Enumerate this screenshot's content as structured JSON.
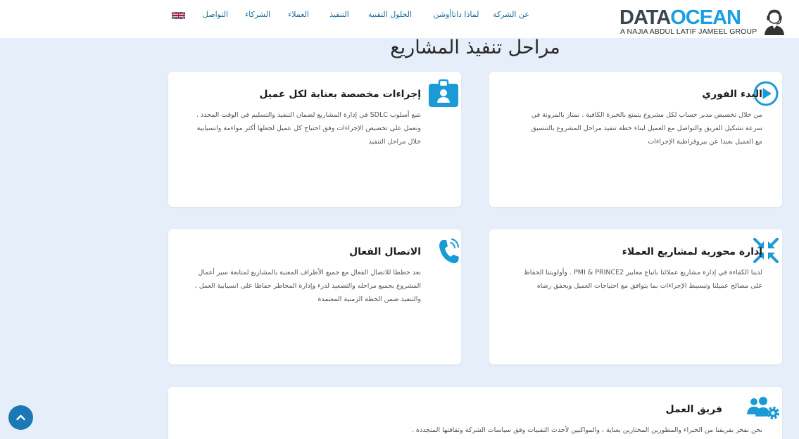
{
  "header": {
    "logo": {
      "main_dark": "DATA",
      "main_accent": "OCEAN",
      "subtitle": "A NAJIA ABDUL LATIF JAMEEL GROUP"
    },
    "nav": [
      {
        "label": "عن الشركة"
      },
      {
        "label": "لماذا داتاأوشن"
      },
      {
        "label": "الحلول التقنية"
      },
      {
        "label": "التنفيذ"
      },
      {
        "label": "العملاء"
      },
      {
        "label": "الشركاء"
      },
      {
        "label": "التواصل"
      }
    ],
    "language_flag": "uk-flag-icon"
  },
  "section": {
    "title": "مراحل تنفيذ المشاريع"
  },
  "cards": [
    {
      "title": "البدء الفوري",
      "icon": "play-circle-icon",
      "text": "من خلال تخصيص مدير حساب لكل مشروع يتمتع بالخبرة الكافية . نمتاز بالمرونة في سرعة تشكيل الفريق والتواصل مع العميل لبناء خطة تنفيذ مراحل المشروع بالتنسيق مع العميل بعيدا عن بيروقراطية الإجراءات"
    },
    {
      "title": "إجراءات مخصصة بعناية لكل عميل",
      "icon": "id-card-icon",
      "text": "نتبع أسلوب SDLC في إدارة المشاريع لضمان التنفيذ والتسليم في الوقت المحدد . ونعمل على تخصيص الإجراءات وفق احتياج كل عميل لجعلها أكثر مواءمة وانسيابية خلال مراحل التنفيذ"
    },
    {
      "title": "إدارة محورية لمشاريع العملاء",
      "icon": "compress-arrows-icon",
      "text": "لدينا الكفاءة في إدارة مشاريع عملائنا باتباع معايير PMI & PRINCE2 . وأولويتنا الحفاظ على مصالح عميلنا وتبسيط الإجراءات بما يتوافق مع احتياجات العميل ويحقق رضاه"
    },
    {
      "title": "الاتصال الفعال",
      "icon": "phone-ringing-icon",
      "text": "نعد خططا للاتصال الفعال مع جميع الأطراف المعنية بالمشاريع لمتابعة سير أعمال المشروع بجميع مراحله والتصعيد لدرء وإدارة المخاطر حفاظا على انسيابية العمل ، والتنفيذ ضمن الخطة الزمنية المعتمدة"
    },
    {
      "title": "فريق العمل",
      "icon": "team-gear-icon",
      "text": "نحن نفخر بفريقنا من الخبراء والمطورين المختارين بعناية ، والمواكبين لأحدث التقنيات وفق سياسات الشركة وثقافتها المتجددة ."
    }
  ],
  "colors": {
    "accent": "#1aa0e0",
    "icon_blue": "#1a9ad6",
    "background": "#e6eef9",
    "nav_text": "#1e6f9d"
  },
  "scroll_top_icon": "chevron-up-icon"
}
